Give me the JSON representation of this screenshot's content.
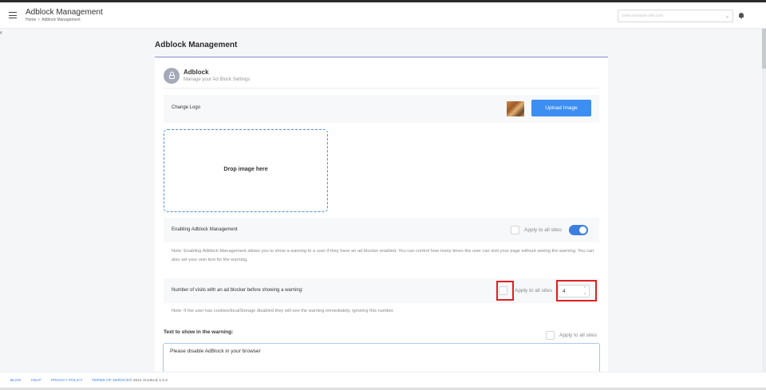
{
  "header": {
    "title": "Adblock Management",
    "breadcrumb": {
      "home": "Home",
      "separator": ">",
      "current": "Adblock Management"
    },
    "site_select_value": "www.example-site.com"
  },
  "page": {
    "title": "Adblock Management"
  },
  "card": {
    "title": "Adblock",
    "subtitle": "Manage your Ad Block Settings"
  },
  "change_logo": {
    "label": "Change Logo",
    "upload_button": "Upload Image"
  },
  "dropzone": {
    "text": "Drop image here"
  },
  "enabling": {
    "label": "Enabling Adblock Management",
    "apply_label": "Apply to all sites",
    "toggle_on": true,
    "note": "Note: Enabling Adblock Management allows you to show a warning to a user if they have an ad blocker enabled. You can control how many times the user can visit your page without seeing the warning. You can also set your own text for the warning."
  },
  "visits": {
    "label": "Number of visits with an ad blocker before showing a warning:",
    "apply_label": "Apply to all sites",
    "value": "4",
    "note": "Note: If the user has cookies/localStorage disabled they will see the warning immediately, ignoring this number."
  },
  "warning_text": {
    "label": "Text to show in the warning:",
    "apply_label": "Apply to all sites",
    "value": "Please disable AdBlock in your browser"
  },
  "footer": {
    "links": [
      "BLOG",
      "HELP",
      "PRIVACY POLICY",
      "TERMS OF SERVICE"
    ],
    "copyright": "© 2021 VUUKLE 1.0.2"
  },
  "colors": {
    "accent": "#3d8ef2",
    "highlight": "#e02020",
    "title_underline": "#8a8fd6"
  }
}
